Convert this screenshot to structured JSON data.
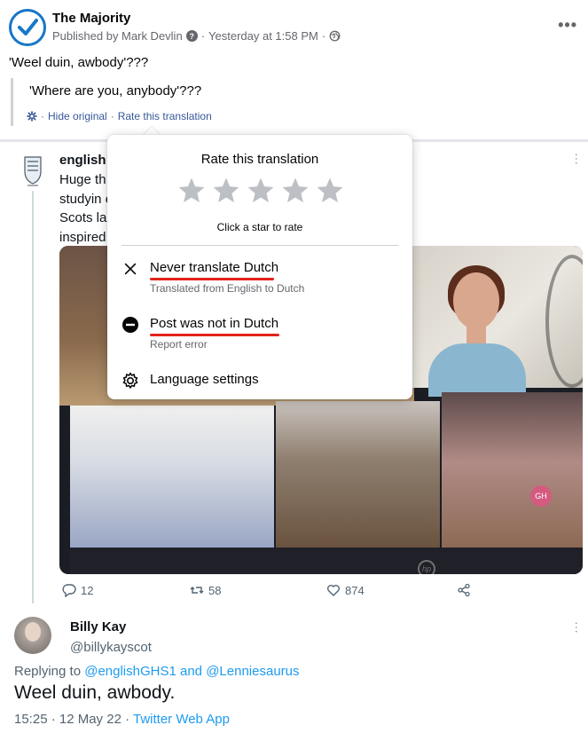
{
  "fb_post": {
    "page_name": "The Majority",
    "published_by": "Published by Mark Devlin",
    "timestamp": "Yesterday at 1:58 PM",
    "meta_separator": "·",
    "more_label": "•••",
    "translated_text": "'Weel duin, awbody'???",
    "original_text": "'Where are you, anybody'???",
    "hide_original": "Hide original",
    "rate_translation": "Rate this translation"
  },
  "tweet": {
    "author": "english",
    "text_lines": [
      "Huge th                                                              sses today as part our unit",
      "studyin                                                              er writing, the value of the",
      "Scots la                                                             es. Pupils & staff were all",
      "inspired"
    ],
    "gh_badge": "GH",
    "hp_logo": "hp",
    "replies": "12",
    "retweets": "58",
    "likes": "874"
  },
  "reply": {
    "name": "Billy Kay",
    "handle": "@billykayscot",
    "replying_prefix": "Replying to",
    "mention_1": "@englishGHS1",
    "conjunction": "and",
    "mention_2": "@Lenniesaurus",
    "text": "Weel duin, awbody.",
    "meta_time": "15:25 · 12 May 22 ·",
    "meta_app": "Twitter Web App"
  },
  "popup": {
    "title": "Rate this translation",
    "star_count": 5,
    "click_hint": "Click a star to rate",
    "never_translate": "Never translate Dutch",
    "never_translate_sub": "Translated from English to Dutch",
    "not_dutch": "Post was not in Dutch",
    "not_dutch_sub": "Report error",
    "language_settings": "Language settings"
  },
  "colors": {
    "facebook_blue": "#1877c8",
    "link_blue": "#385898",
    "twitter_blue": "#1d9bf0",
    "star_gray": "#bcc0c4",
    "annotation_red": "#e2231a"
  }
}
